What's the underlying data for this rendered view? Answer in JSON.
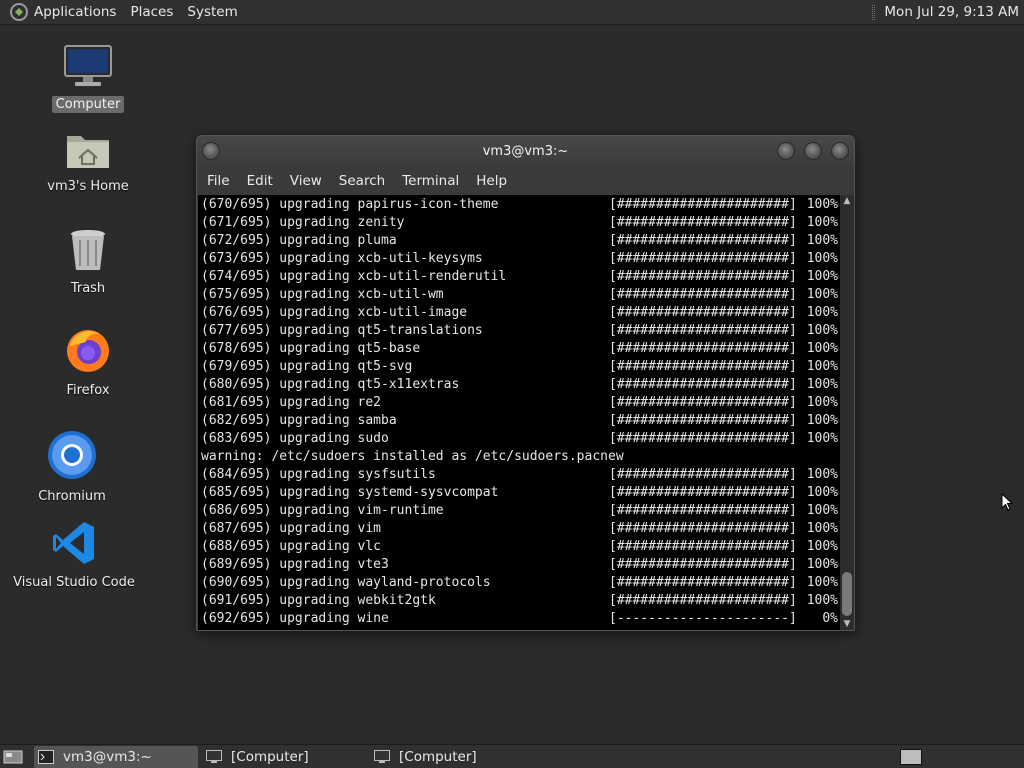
{
  "top_panel": {
    "menus": [
      "Applications",
      "Places",
      "System"
    ],
    "clock": "Mon Jul 29,  9:13 AM"
  },
  "desktop_icons": [
    {
      "label": "Computer",
      "icon": "computer-icon",
      "selected": true
    },
    {
      "label": "vm3's Home",
      "icon": "home-folder-icon",
      "selected": false
    },
    {
      "label": "Trash",
      "icon": "trash-icon",
      "selected": false
    },
    {
      "label": "Firefox",
      "icon": "firefox-icon",
      "selected": false
    },
    {
      "label": "Chromium",
      "icon": "chromium-icon",
      "selected": false
    },
    {
      "label": "Visual Studio Code",
      "icon": "vscode-icon",
      "selected": false
    }
  ],
  "window": {
    "title": "vm3@vm3:~",
    "menus": [
      "File",
      "Edit",
      "View",
      "Search",
      "Terminal",
      "Help"
    ]
  },
  "terminal_lines": [
    {
      "text": "(670/695) upgrading papirus-icon-theme",
      "bar": "[######################]",
      "pct": "100%"
    },
    {
      "text": "(671/695) upgrading zenity",
      "bar": "[######################]",
      "pct": "100%"
    },
    {
      "text": "(672/695) upgrading pluma",
      "bar": "[######################]",
      "pct": "100%"
    },
    {
      "text": "(673/695) upgrading xcb-util-keysyms",
      "bar": "[######################]",
      "pct": "100%"
    },
    {
      "text": "(674/695) upgrading xcb-util-renderutil",
      "bar": "[######################]",
      "pct": "100%"
    },
    {
      "text": "(675/695) upgrading xcb-util-wm",
      "bar": "[######################]",
      "pct": "100%"
    },
    {
      "text": "(676/695) upgrading xcb-util-image",
      "bar": "[######################]",
      "pct": "100%"
    },
    {
      "text": "(677/695) upgrading qt5-translations",
      "bar": "[######################]",
      "pct": "100%"
    },
    {
      "text": "(678/695) upgrading qt5-base",
      "bar": "[######################]",
      "pct": "100%"
    },
    {
      "text": "(679/695) upgrading qt5-svg",
      "bar": "[######################]",
      "pct": "100%"
    },
    {
      "text": "(680/695) upgrading qt5-x11extras",
      "bar": "[######################]",
      "pct": "100%"
    },
    {
      "text": "(681/695) upgrading re2",
      "bar": "[######################]",
      "pct": "100%"
    },
    {
      "text": "(682/695) upgrading samba",
      "bar": "[######################]",
      "pct": "100%"
    },
    {
      "text": "(683/695) upgrading sudo",
      "bar": "[######################]",
      "pct": "100%"
    },
    {
      "text": "warning: /etc/sudoers installed as /etc/sudoers.pacnew",
      "bar": "",
      "pct": ""
    },
    {
      "text": "(684/695) upgrading sysfsutils",
      "bar": "[######################]",
      "pct": "100%"
    },
    {
      "text": "(685/695) upgrading systemd-sysvcompat",
      "bar": "[######################]",
      "pct": "100%"
    },
    {
      "text": "(686/695) upgrading vim-runtime",
      "bar": "[######################]",
      "pct": "100%"
    },
    {
      "text": "(687/695) upgrading vim",
      "bar": "[######################]",
      "pct": "100%"
    },
    {
      "text": "(688/695) upgrading vlc",
      "bar": "[######################]",
      "pct": "100%"
    },
    {
      "text": "(689/695) upgrading vte3",
      "bar": "[######################]",
      "pct": "100%"
    },
    {
      "text": "(690/695) upgrading wayland-protocols",
      "bar": "[######################]",
      "pct": "100%"
    },
    {
      "text": "(691/695) upgrading webkit2gtk",
      "bar": "[######################]",
      "pct": "100%"
    },
    {
      "text": "(692/695) upgrading wine",
      "bar": "[----------------------]",
      "pct": "0%"
    }
  ],
  "taskbar": {
    "tasks": [
      {
        "label": "vm3@vm3:~",
        "active": true
      },
      {
        "label": "[Computer]",
        "active": false
      },
      {
        "label": "[Computer]",
        "active": false
      }
    ]
  },
  "colors": {
    "panel": "#303030",
    "desktop": "#2b2b2b",
    "terminal_bg": "#000000",
    "terminal_fg": "#e6e6e6"
  }
}
